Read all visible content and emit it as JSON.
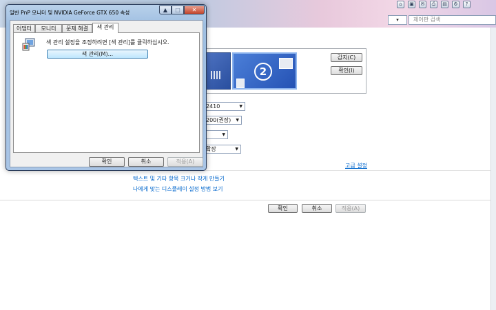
{
  "background_window": {
    "search_placeholder": "제어판 검색",
    "address_dropdown_glyph": "▾",
    "tray_icons": [
      "home-icon",
      "feed-icon",
      "mail-icon",
      "print-icon",
      "page-icon",
      "tools-icon",
      "help-icon"
    ],
    "monitor_preview": {
      "selected_monitor_number": "2"
    },
    "detect_label": "감지(C)",
    "identify_label": "확인(I)",
    "display_select_value": "2410",
    "resolution_select_value": "200(권장)",
    "orientation_select_value": "",
    "multiple_displays_select_value": "확장",
    "advanced_settings_link": "고급 설정",
    "links": [
      "텍스트 및 기타 항목 크거나 작게 만들기",
      "나에게 맞는 디스플레이 설정 방법 보기"
    ],
    "ok_label": "확인",
    "cancel_label": "취소",
    "apply_label": "적용(A)"
  },
  "dialog": {
    "title": "일반 PnP 모니터 및 NVIDIA GeForce GTX 650 속성",
    "close_glyph": "✕",
    "minimize_glyph": "▲",
    "maximize_glyph": "□",
    "tabs": [
      "어댑터",
      "모니터",
      "문제 해결",
      "색 관리"
    ],
    "active_tab": "색 관리",
    "color_management": {
      "instruction": "색 관리 설정을 조정하려면 [색 관리]를 클릭하십시오.",
      "button_label": "색 관리(M)..."
    },
    "ok_label": "확인",
    "cancel_label": "취소",
    "apply_label": "적용(A)"
  },
  "colors": {
    "accent_link": "#0066cc",
    "title_gradient_blue": "#a9c5e6",
    "close_red": "#c2452c"
  }
}
